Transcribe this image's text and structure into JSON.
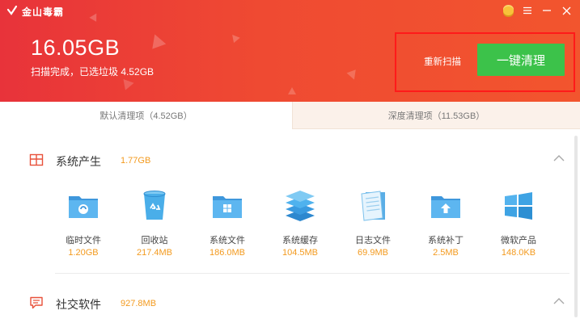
{
  "app": {
    "logo_icon": "kingsoft-logo-icon",
    "name": "金山毒霸"
  },
  "window_controls": [
    "coin-icon",
    "menu-icon",
    "minimize-icon",
    "close-icon"
  ],
  "summary": {
    "total_size": "16.05GB",
    "status": "扫描完成，已选垃圾 4.52GB"
  },
  "actions": {
    "rescan_label": "重新扫描",
    "clean_label": "一键清理"
  },
  "tabs": [
    {
      "label": "默认清理项（4.52GB）",
      "active": true
    },
    {
      "label": "深度清理项（11.53GB）",
      "active": false
    }
  ],
  "sections": [
    {
      "title": "系统产生",
      "size": "1.77GB",
      "icon": "windows-system-icon",
      "items": [
        {
          "name": "临时文件",
          "size": "1.20GB",
          "icon": "temp-folder-icon"
        },
        {
          "name": "回收站",
          "size": "217.4MB",
          "icon": "recycle-bin-icon"
        },
        {
          "name": "系统文件",
          "size": "186.0MB",
          "icon": "system-folder-icon"
        },
        {
          "name": "系统缓存",
          "size": "104.5MB",
          "icon": "system-cache-icon"
        },
        {
          "name": "日志文件",
          "size": "69.9MB",
          "icon": "log-file-icon"
        },
        {
          "name": "系统补丁",
          "size": "2.5MB",
          "icon": "patch-folder-icon"
        },
        {
          "name": "微软产品",
          "size": "148.0KB",
          "icon": "microsoft-product-icon"
        }
      ]
    },
    {
      "title": "社交软件",
      "size": "927.8MB",
      "icon": "chat-icon"
    }
  ],
  "colors": {
    "header_start": "#e8333a",
    "header_end": "#f2552e",
    "clean_button": "#3cc24a",
    "size_accent": "#f39a1e",
    "highlight_border": "#ff1a1a"
  }
}
